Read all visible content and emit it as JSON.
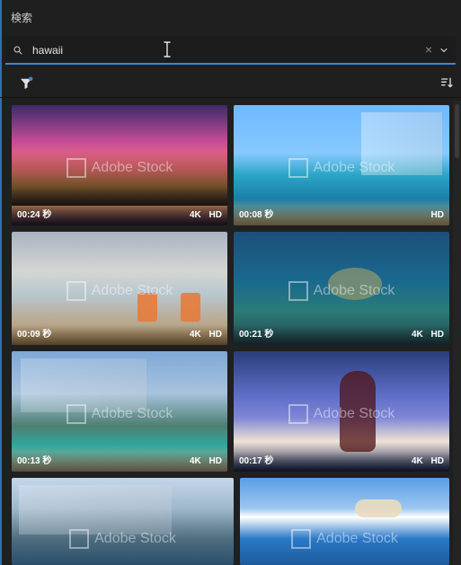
{
  "panel": {
    "title": "検索",
    "search": {
      "query": "hawaii",
      "placeholder": ""
    }
  },
  "icons": {
    "search": "search-icon",
    "clear": "close-icon",
    "dropdown": "chevron-down-icon",
    "filter": "filter-icon",
    "sort": "sort-icon",
    "cursor": "text-cursor-icon"
  },
  "colors": {
    "accent": "#3a86d8",
    "filter_dot": "#3a86d8"
  },
  "results": [
    {
      "duration": "00:24 秒",
      "badges": [
        "4K",
        "HD"
      ],
      "watermark": "Adobe Stock"
    },
    {
      "duration": "00:08 秒",
      "badges": [
        "HD"
      ],
      "watermark": "Adobe Stock"
    },
    {
      "duration": "00:09 秒",
      "badges": [
        "4K",
        "HD"
      ],
      "watermark": "Adobe Stock"
    },
    {
      "duration": "00:21 秒",
      "badges": [
        "4K",
        "HD"
      ],
      "watermark": "Adobe Stock"
    },
    {
      "duration": "00:13 秒",
      "badges": [
        "4K",
        "HD"
      ],
      "watermark": "Adobe Stock"
    },
    {
      "duration": "00:17 秒",
      "badges": [
        "4K",
        "HD"
      ],
      "watermark": "Adobe Stock"
    },
    {
      "duration": "",
      "badges": [],
      "watermark": "Adobe Stock"
    },
    {
      "duration": "",
      "badges": [],
      "watermark": "Adobe Stock"
    }
  ]
}
